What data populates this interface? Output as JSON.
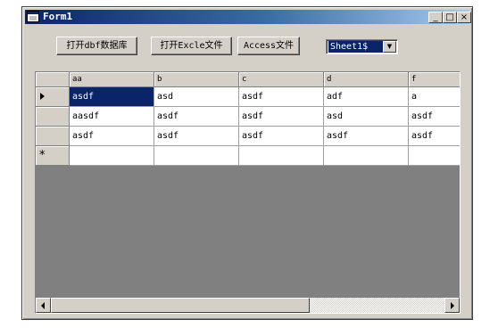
{
  "window": {
    "title": "Form1",
    "controls": {
      "minimize": "_",
      "maximize": "□",
      "close": "×"
    }
  },
  "toolbar": {
    "buttons": [
      {
        "label": "打开dbf数据库"
      },
      {
        "label": "打开Excle文件"
      },
      {
        "label": "Access文件"
      }
    ],
    "combo": {
      "selected": "Sheet1$",
      "arrow_icon": "▼"
    }
  },
  "grid": {
    "columns": [
      "aa",
      "b",
      "c",
      "d",
      "f"
    ],
    "rows": [
      [
        "asdf",
        "asd",
        "asdf",
        "adf",
        "a"
      ],
      [
        "aasdf",
        "asdf",
        "asdf",
        "asd",
        "asdf"
      ],
      [
        "asdf",
        "asdf",
        "asdf",
        "asdf",
        "asdf"
      ],
      [
        "",
        "",
        "",
        "",
        ""
      ]
    ],
    "row_headers": [
      "current-row-arrow-icon",
      "",
      "",
      "new-row-star-icon"
    ],
    "new_row_marker": "*",
    "selected_cell": {
      "row": 0,
      "col": 0
    },
    "selection_color": "#0a246a",
    "empty_area_color": "#808080"
  }
}
